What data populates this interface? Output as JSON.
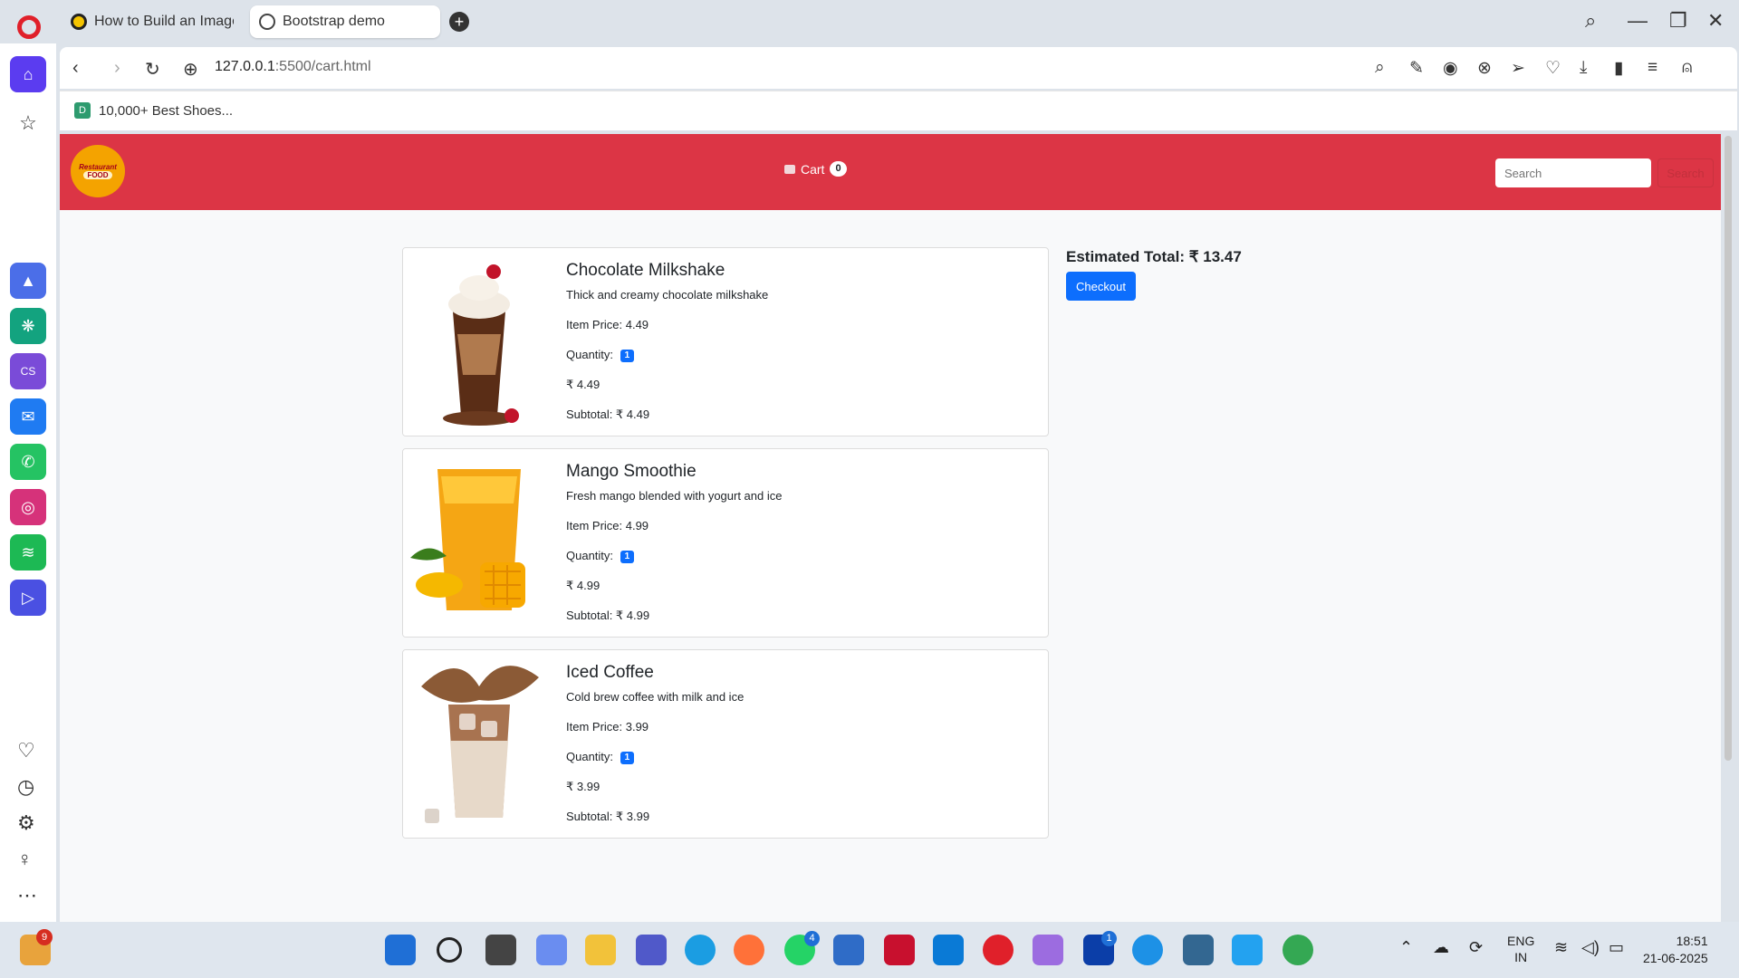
{
  "browser": {
    "tabs": [
      {
        "title": "How to Build an Image Se",
        "active": false
      },
      {
        "title": "Bootstrap demo",
        "active": true
      }
    ],
    "url_host": "127.0.0.1",
    "url_path": ":5500/cart.html",
    "bookmark": "10,000+ Best Shoes...",
    "bookmark_icon": "D"
  },
  "site": {
    "logo_line1": "Restaurant",
    "logo_line2": "FOOD",
    "cart_label": "Cart",
    "cart_count": "0",
    "search_placeholder": "Search",
    "search_button": "Search"
  },
  "cart": {
    "items": [
      {
        "name": "Chocolate Milkshake",
        "description": "Thick and creamy chocolate milkshake",
        "item_price": "Item Price: 4.49",
        "quantity_label": "Quantity:",
        "quantity": "1",
        "price": "₹ 4.49",
        "subtotal": "Subtotal: ₹ 4.49"
      },
      {
        "name": "Mango Smoothie",
        "description": "Fresh mango blended with yogurt and ice",
        "item_price": "Item Price: 4.99",
        "quantity_label": "Quantity:",
        "quantity": "1",
        "price": "₹ 4.99",
        "subtotal": "Subtotal: ₹ 4.99"
      },
      {
        "name": "Iced Coffee",
        "description": "Cold brew coffee with milk and ice",
        "item_price": "Item Price: 3.99",
        "quantity_label": "Quantity:",
        "quantity": "1",
        "price": "₹ 3.99",
        "subtotal": "Subtotal: ₹ 3.99"
      }
    ],
    "estimated_total": "Estimated Total: ₹ 13.47",
    "checkout_label": "Checkout"
  },
  "taskbar": {
    "notification_badge": "9",
    "whatsapp_badge": "4",
    "l_badge": "1",
    "language": "ENG",
    "region": "IN",
    "time": "18:51",
    "date": "21-06-2025"
  },
  "colors": {
    "header": "#dc3545",
    "primary": "#0d6efd",
    "opera": "#e0202a",
    "sidebar_accent": "#5b3cf0"
  }
}
